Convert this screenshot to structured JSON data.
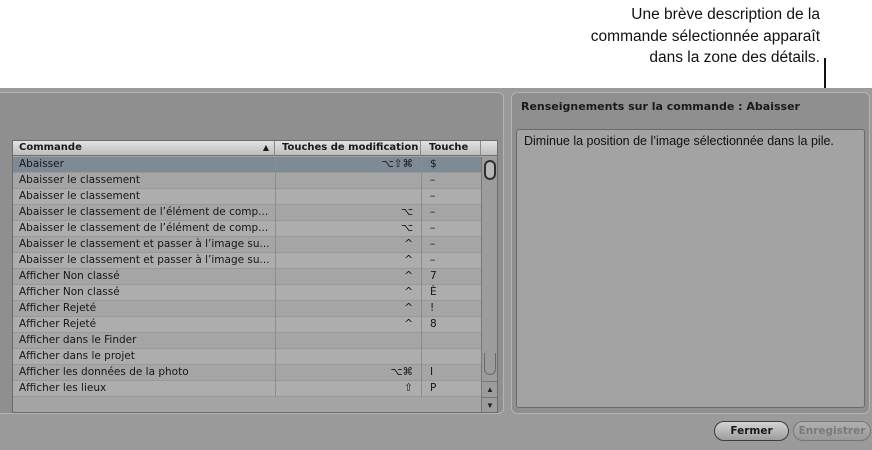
{
  "callout": {
    "line1": "Une brève description de la",
    "line2": "commande sélectionnée apparaît",
    "line3": "dans la zone des détails."
  },
  "table": {
    "columns": [
      "Commande",
      "Touches de modification",
      "Touche"
    ],
    "sort_indicator": "▲",
    "rows": [
      {
        "name": "Abaisser",
        "mod": "⌥⇧⌘",
        "key": "$"
      },
      {
        "name": "Abaisser le classement",
        "mod": "",
        "key": "–"
      },
      {
        "name": "Abaisser le classement",
        "mod": "",
        "key": "–"
      },
      {
        "name": "Abaisser le classement de l’élément de comp...",
        "mod": "⌥",
        "key": "–"
      },
      {
        "name": "Abaisser le classement de l’élément de comp...",
        "mod": "⌥",
        "key": "–"
      },
      {
        "name": "Abaisser le classement et passer à l’image su...",
        "mod": "^",
        "key": "–"
      },
      {
        "name": "Abaisser le classement et passer à l’image su...",
        "mod": "^",
        "key": "–"
      },
      {
        "name": "Afficher Non classé",
        "mod": "^",
        "key": "7"
      },
      {
        "name": "Afficher Non classé",
        "mod": "^",
        "key": "È"
      },
      {
        "name": "Afficher Rejeté",
        "mod": "^",
        "key": "!"
      },
      {
        "name": "Afficher Rejeté",
        "mod": "^",
        "key": "8"
      },
      {
        "name": "Afficher dans le Finder",
        "mod": "",
        "key": ""
      },
      {
        "name": "Afficher dans le projet",
        "mod": "",
        "key": ""
      },
      {
        "name": "Afficher les données de la photo",
        "mod": "⌥⌘",
        "key": "I"
      },
      {
        "name": "Afficher les lieux",
        "mod": "⇧",
        "key": "P"
      }
    ],
    "selected_index": 0
  },
  "details": {
    "title": "Renseignements sur la commande : Abaisser",
    "text": "Diminue la position de l’image sélectionnée dans la pile."
  },
  "buttons": {
    "close": "Fermer",
    "save": "Enregistrer"
  },
  "scrollbar": {
    "up_glyph": "▲",
    "down_glyph": "▼"
  }
}
